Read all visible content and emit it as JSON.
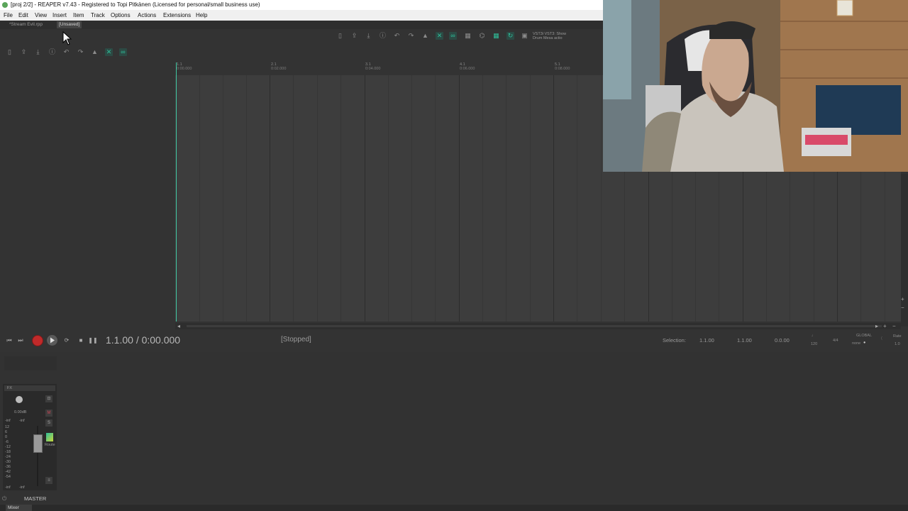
{
  "window": {
    "title": "[proj 2/2] - REAPER v7.43 - Registered to Topi Pitkänen (Licensed for personal/small business use)"
  },
  "menu": [
    "File",
    "Edit",
    "View",
    "Insert",
    "Item",
    "Track",
    "Options",
    "Actions",
    "Extensions",
    "Help"
  ],
  "project_tabs": [
    "*Stream Evil.rpp",
    "[Unsaved]"
  ],
  "toolbar_vst_text": {
    "line1": "VST3i  VST3:  Show",
    "line2": "Drum  Mesa  actio"
  },
  "ruler": [
    {
      "bar": "1.1",
      "time": "0:00.000"
    },
    {
      "bar": "2.1",
      "time": "0:02.000"
    },
    {
      "bar": "3.1",
      "time": "0:04.000"
    },
    {
      "bar": "4.1",
      "time": "0:06.000"
    },
    {
      "bar": "5.1",
      "time": "0:08.000"
    }
  ],
  "transport": {
    "position": "1.1.00 / 0:00.000",
    "status": "[Stopped]",
    "selection_label": "Selection:",
    "selection_start": "1.1.00",
    "selection_end": "1.1.00",
    "selection_length": "0.0.00",
    "bpm": "120",
    "time_signature": "4/4",
    "global_label": "GLOBAL",
    "global_value": "none",
    "rate_label": "Rate",
    "rate_value": "1.0"
  },
  "mixer": {
    "fx_label": "FX",
    "volume_db": "0.00dB",
    "peak_left": "-inf",
    "peak_right": "-inf",
    "bottom_left": "-inf",
    "bottom_right": "-inf",
    "route_label": "Route",
    "scale": [
      "12",
      "6",
      "0",
      "-6",
      "-12",
      "-18",
      "-24",
      "-30",
      "-36",
      "-42",
      "-54"
    ],
    "master_name": "MASTER",
    "tab_label": "Mixer"
  },
  "colors": {
    "accent": "#2fbf9a",
    "record": "#c02a2a",
    "background": "#333333"
  }
}
